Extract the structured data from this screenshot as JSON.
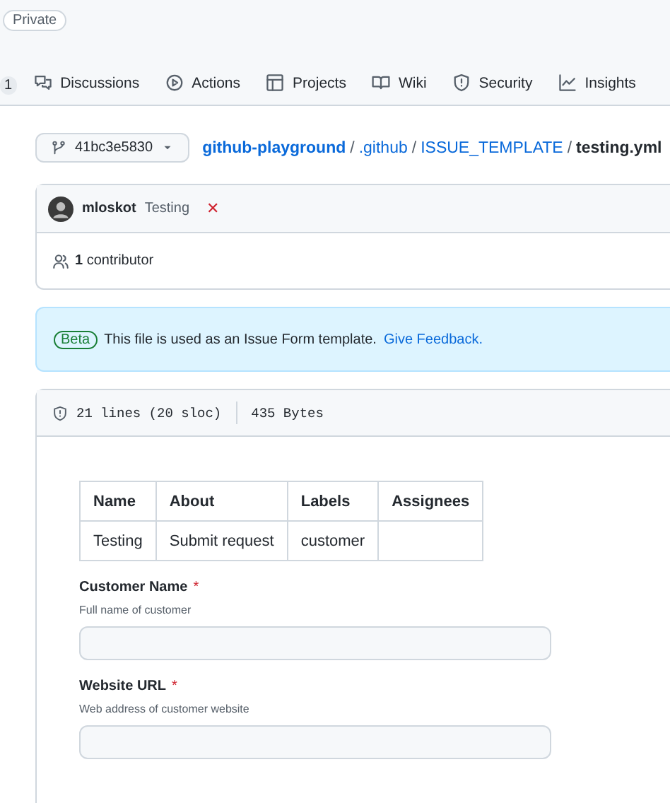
{
  "repo": {
    "visibility": "Private"
  },
  "nav": {
    "counter": "1",
    "tabs": [
      {
        "label": "Discussions",
        "selected": false
      },
      {
        "label": "Actions",
        "selected": false
      },
      {
        "label": "Projects",
        "selected": false
      },
      {
        "label": "Wiki",
        "selected": false
      },
      {
        "label": "Security",
        "selected": false
      },
      {
        "label": "Insights",
        "selected": false
      }
    ]
  },
  "branch": "41bc3e5830",
  "breadcrumb": {
    "links": [
      "github-playground",
      ".github",
      "ISSUE_TEMPLATE"
    ],
    "separator": "/",
    "file": "testing.yml"
  },
  "commit": {
    "author": "mloskot",
    "message": "Testing",
    "status_mark": "✕",
    "contributors_count": "1",
    "contributors_label": "contributor"
  },
  "banner": {
    "badge": "Beta",
    "text": "This file is used as an Issue Form template.",
    "link": "Give Feedback."
  },
  "file_info": {
    "lines": "21 lines (20 sloc)",
    "size": "435 Bytes"
  },
  "table": {
    "columns": [
      "Name",
      "About",
      "Labels",
      "Assignees"
    ],
    "rows": [
      [
        "Testing",
        "Submit request",
        "customer",
        ""
      ]
    ]
  },
  "fields": [
    {
      "label": "Customer Name",
      "required_mark": "*",
      "description": "Full name of customer"
    },
    {
      "label": "Website URL",
      "required_mark": "*",
      "description": "Web address of customer website"
    }
  ]
}
